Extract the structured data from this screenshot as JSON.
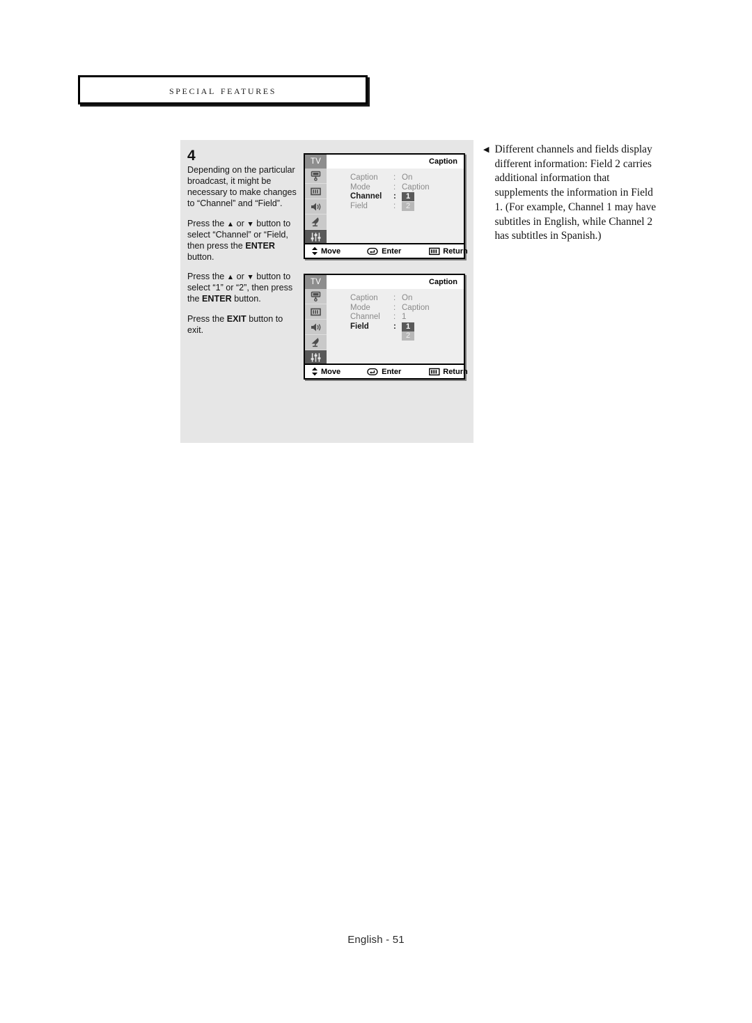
{
  "header": {
    "section_title": "Special Features"
  },
  "steps": {
    "number": "4",
    "paragraphs": [
      "Depending on the particular broadcast, it might be necessary to make changes to “Channel” and “Field”.",
      "Press the ▲ or ▼ button to select “Channel” or “Field, then press the ENTER button.",
      "Press the ▲ or ▼ button to select “1” or “2”, then press the ENTER button.",
      "Press the EXIT button to exit."
    ],
    "para1_plain": "Depending on the particular broadcast, it might be necessary to make changes to “Channel” and “Field”.",
    "para2_a": "Press the ",
    "para2_up": "▲",
    "para2_b": " or ",
    "para2_down": "▼",
    "para2_c": " button to select “Channel” or “Field, then press the ",
    "para2_bold": "ENTER",
    "para2_d": " button.",
    "para3_a": "Press the ",
    "para3_up": "▲",
    "para3_b": " or ",
    "para3_down": "▼",
    "para3_c": " button to select “1” or “2”, then press the ",
    "para3_bold": "ENTER",
    "para3_d": " button.",
    "para4_a": "Press the ",
    "para4_bold": "EXIT",
    "para4_b": " button to exit."
  },
  "osd_menus": [
    {
      "tab_label": "TV",
      "title": "Caption",
      "icons": [
        "picture-icon",
        "channel-icon",
        "sound-icon",
        "satellite-icon",
        "setup-icon"
      ],
      "active_icon_index": 4,
      "rows": [
        {
          "label": "Caption",
          "colon": ":",
          "value": "On",
          "value_style": "plain",
          "selected": false
        },
        {
          "label": "Mode",
          "colon": ":",
          "value": "Caption",
          "value_style": "plain",
          "selected": false
        },
        {
          "label": "Channel",
          "colon": ":",
          "value": "1",
          "value_style": "dark",
          "selected": true
        },
        {
          "label": "Field",
          "colon": ":",
          "value": "2",
          "value_style": "light",
          "selected": false
        }
      ],
      "extra_row": null,
      "footer": {
        "move": "Move",
        "enter": "Enter",
        "return": "Return"
      }
    },
    {
      "tab_label": "TV",
      "title": "Caption",
      "icons": [
        "picture-icon",
        "channel-icon",
        "sound-icon",
        "satellite-icon",
        "setup-icon"
      ],
      "active_icon_index": 4,
      "rows": [
        {
          "label": "Caption",
          "colon": ":",
          "value": "On",
          "value_style": "plain",
          "selected": false
        },
        {
          "label": "Mode",
          "colon": ":",
          "value": "Caption",
          "value_style": "plain",
          "selected": false
        },
        {
          "label": "Channel",
          "colon": ":",
          "value": "1",
          "value_style": "plain",
          "selected": false
        },
        {
          "label": "Field",
          "colon": ":",
          "value": "1",
          "value_style": "dark",
          "selected": true
        }
      ],
      "extra_row": {
        "value": "2",
        "value_style": "light"
      },
      "footer": {
        "move": "Move",
        "enter": "Enter",
        "return": "Return"
      }
    }
  ],
  "side_note": {
    "bullet": "◀",
    "text": "Different channels and fields display different information: Field 2 carries additional information that  supplements the information in Field 1. (For example, Channel 1 may have subtitles in English, while Channel 2 has subtitles in Spanish.)"
  },
  "footer": {
    "page_label": "English - 51"
  },
  "colors": {
    "panel_bg": "#e6e6e6",
    "osd_bg": "#eeeeee",
    "osd_iconbar": "#c9c9c9",
    "osd_tab": "#8e8e8e",
    "value_dark": "#5a5a5a",
    "value_light": "#b8b8b8",
    "text_gray": "#8a8a8a"
  }
}
